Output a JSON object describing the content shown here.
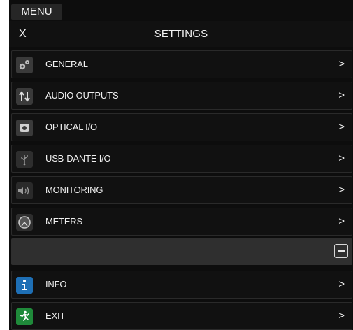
{
  "header": {
    "menu_tab": "MENU",
    "close_label": "X",
    "title": "SETTINGS"
  },
  "items": [
    {
      "label": "GENERAL",
      "icon": "gears-icon",
      "arrow": ">"
    },
    {
      "label": "AUDIO OUTPUTS",
      "icon": "up-down-arrows-icon",
      "arrow": ">"
    },
    {
      "label": "OPTICAL I/O",
      "icon": "optical-port-icon",
      "arrow": ">"
    },
    {
      "label": "USB-DANTE I/O",
      "icon": "usb-icon",
      "arrow": ">"
    },
    {
      "label": "MONITORING",
      "icon": "speaker-icon",
      "arrow": ">"
    },
    {
      "label": "METERS",
      "icon": "gauge-icon",
      "arrow": ">"
    },
    {
      "label": "INFO",
      "icon": "info-icon",
      "arrow": ">"
    },
    {
      "label": "EXIT",
      "icon": "exit-running-man-icon",
      "arrow": ">"
    }
  ],
  "colors": {
    "info_accent": "#1e6fb5",
    "exit_accent": "#1f8a3a"
  }
}
